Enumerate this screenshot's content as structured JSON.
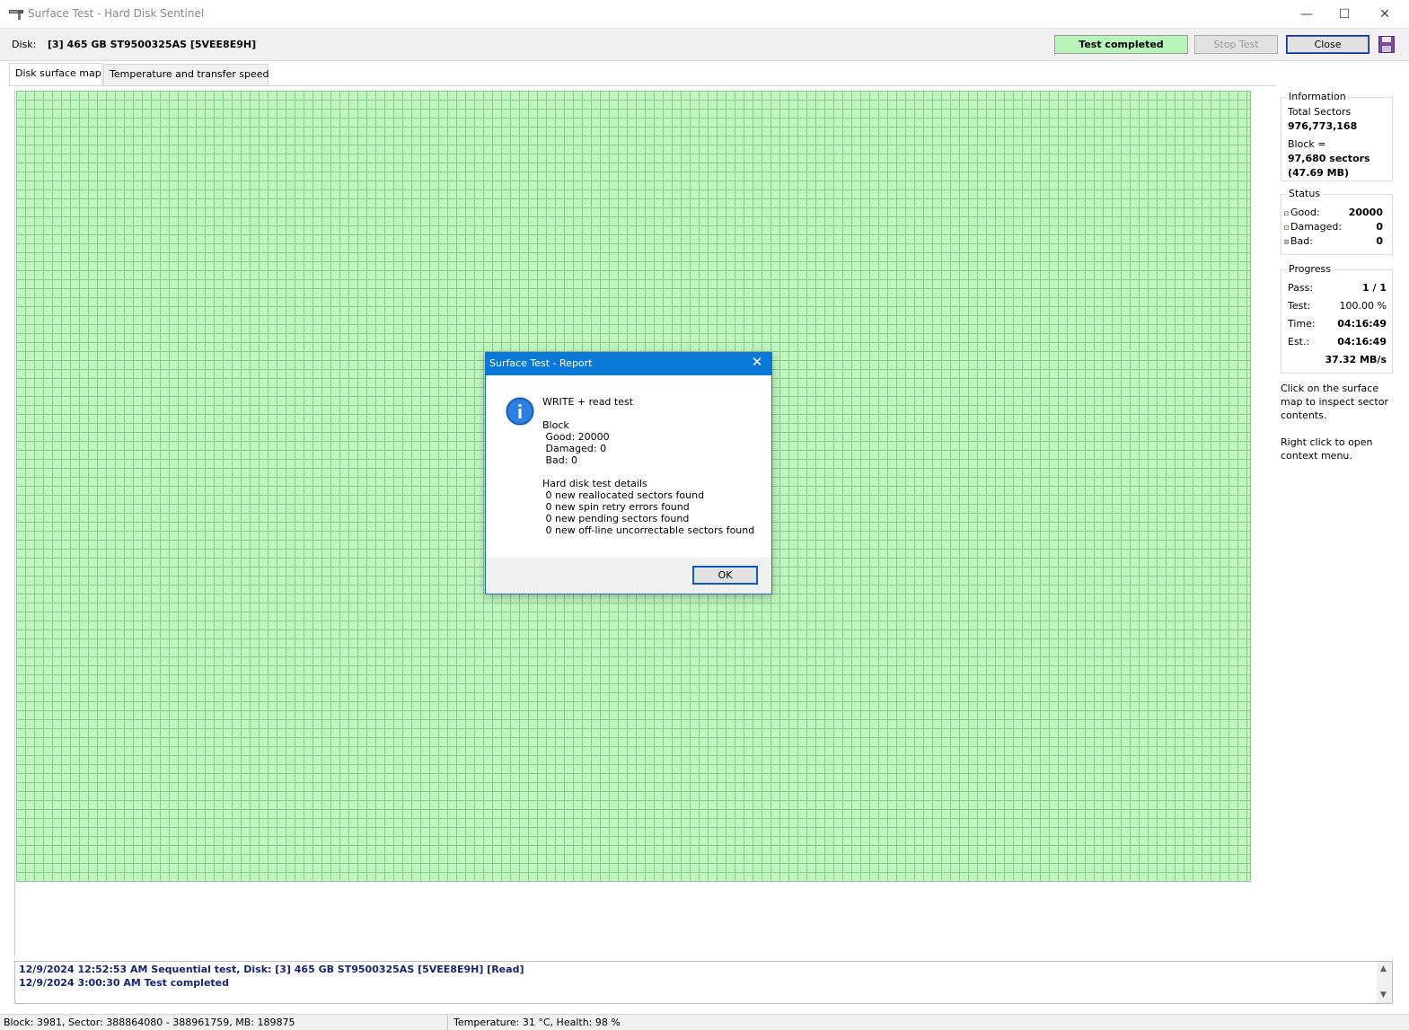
{
  "window": {
    "title": "Surface Test - Hard Disk Sentinel",
    "minimize_glyph": "—",
    "maximize_glyph": "☐",
    "close_glyph": "✕"
  },
  "diskbar": {
    "label": "Disk:",
    "value": "[3] 465 GB  ST9500325AS [5VEE8E9H]",
    "status": "Test completed",
    "stop_label": "Stop Test",
    "close_label": "Close"
  },
  "tabs": [
    {
      "label": "Disk surface map"
    },
    {
      "label": "Temperature and transfer speed"
    }
  ],
  "panel": {
    "information": {
      "legend": "Information",
      "total_sectors_label": "Total Sectors",
      "total_sectors_value": "976,773,168",
      "block_label": "Block =",
      "block_sectors": "97,680 sectors",
      "block_mb": "(47.69 MB)"
    },
    "status": {
      "legend": "Status",
      "good_label": "Good:",
      "good_value": "20000",
      "damaged_label": "Damaged:",
      "damaged_value": "0",
      "bad_label": "Bad:",
      "bad_value": "0"
    },
    "progress": {
      "legend": "Progress",
      "pass_label": "Pass:",
      "pass_value": "1 / 1",
      "test_label": "Test:",
      "test_value": "100.00 %",
      "time_label": "Time:",
      "time_value": "04:16:49",
      "est_label": "Est.:",
      "est_value": "04:16:49",
      "speed_value": "37.32 MB/s"
    },
    "hint1": "Click on the surface map to inspect sector contents.",
    "hint2": "Right click to open context menu."
  },
  "colors": {
    "good": "#bff5bf",
    "damaged": "#f5f2a8",
    "bad": "#f0a0b0",
    "accent": "#0a78d7"
  },
  "log": {
    "lines": [
      "12/9/2024  12:52:53 AM   Sequential test, Disk: [3] 465 GB  ST9500325AS [5VEE8E9H] [Read]",
      "12/9/2024  3:00:30 AM   Test completed"
    ],
    "scroll_up": "▲",
    "scroll_down": "▼"
  },
  "statusbar": {
    "block_info": "Block: 3981, Sector: 388864080 - 388961759, MB: 189875",
    "temp_health": "Temperature: 31  °C,  Health: 98 %"
  },
  "dialog": {
    "title": "Surface Test - Report",
    "close_glyph": "✕",
    "heading": "WRITE + read test",
    "block_label": "Block",
    "good": " Good: 20000",
    "damaged": " Damaged: 0",
    "bad": " Bad: 0",
    "details_label": "Hard disk test details",
    "details": [
      " 0 new reallocated sectors found",
      " 0 new spin retry errors found",
      " 0 new pending sectors found",
      " 0 new off-line uncorrectable sectors found"
    ],
    "ok_label": "OK"
  }
}
